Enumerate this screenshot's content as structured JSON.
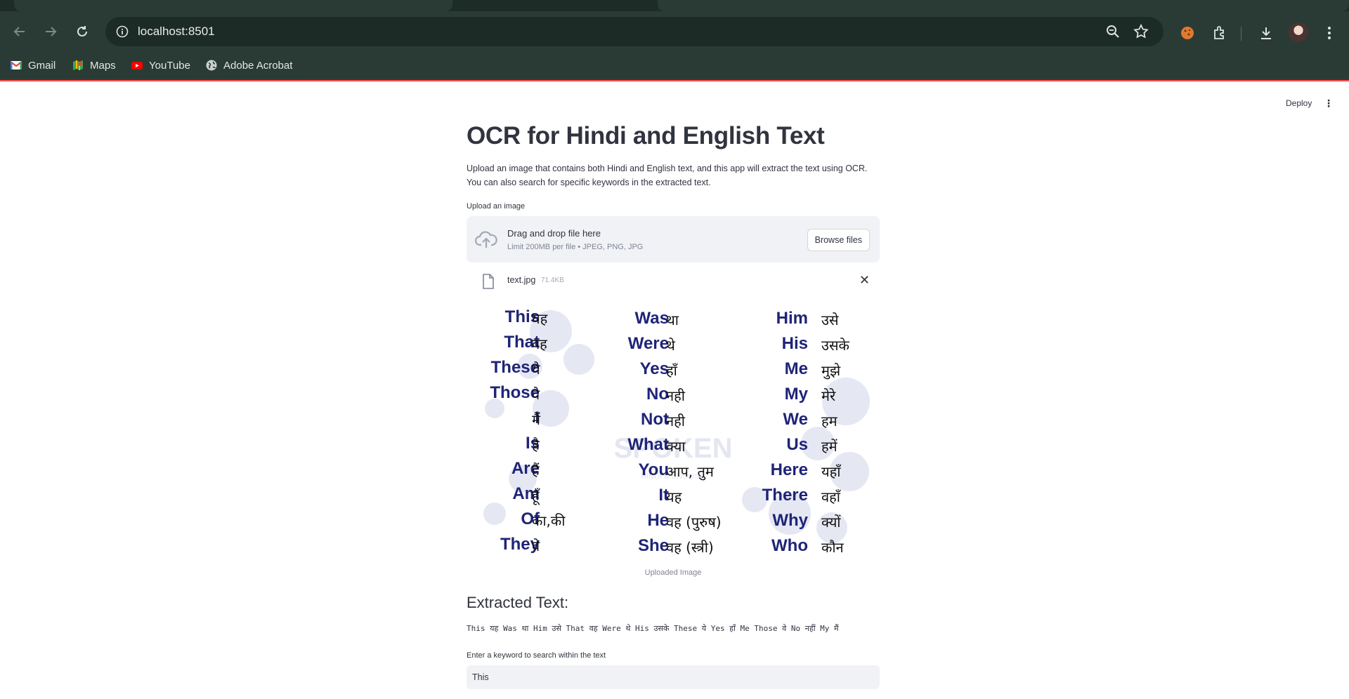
{
  "browser": {
    "url": "localhost:8501",
    "bookmarks": [
      {
        "label": "Gmail",
        "icon": "gmail-icon"
      },
      {
        "label": "Maps",
        "icon": "maps-icon"
      },
      {
        "label": "YouTube",
        "icon": "youtube-icon"
      },
      {
        "label": "Adobe Acrobat",
        "icon": "globe-icon"
      }
    ]
  },
  "app": {
    "deploy_label": "Deploy",
    "title": "OCR for Hindi and English Text",
    "description_line1": "Upload an image that contains both Hindi and English text, and this app will extract the text using OCR.",
    "description_line2": "You can also search for specific keywords in the extracted text.",
    "upload_label": "Upload an image",
    "dropzone_title": "Drag and drop file here",
    "dropzone_limit": "Limit 200MB per file • JPEG, PNG, JPG",
    "browse_label": "Browse files",
    "file_name": "text.jpg",
    "file_size": "71.4KB",
    "image_caption": "Uploaded Image",
    "extracted_heading": "Extracted Text:",
    "extracted_text": "This यह Was था Him उसे That वह Were थे His उसके These ये Yes हाँ Me Those वे No   नहीं My मैं",
    "keyword_label": "Enter a keyword to search within the text",
    "keyword_value": "This"
  },
  "image_words": {
    "col1": [
      {
        "en": "This",
        "hi": "यह"
      },
      {
        "en": "That",
        "hi": "वह"
      },
      {
        "en": "These",
        "hi": "ये"
      },
      {
        "en": "Those",
        "hi": "वे"
      },
      {
        "en": "I",
        "hi": "मैं"
      },
      {
        "en": "Is",
        "hi": "है"
      },
      {
        "en": "Are",
        "hi": "हैं"
      },
      {
        "en": "Am",
        "hi": "हूँ"
      },
      {
        "en": "Of",
        "hi": "का,की"
      },
      {
        "en": "They",
        "hi": "वे"
      }
    ],
    "col2": [
      {
        "en": "Was",
        "hi": "था"
      },
      {
        "en": "Were",
        "hi": "थे"
      },
      {
        "en": "Yes",
        "hi": "हाँ"
      },
      {
        "en": "No",
        "hi": "नही"
      },
      {
        "en": "Not",
        "hi": "नही"
      },
      {
        "en": "What",
        "hi": "क्या"
      },
      {
        "en": "You",
        "hi": "आप, तुम"
      },
      {
        "en": "It",
        "hi": "यह"
      },
      {
        "en": "He",
        "hi": "वह (पुरुष)"
      },
      {
        "en": "She",
        "hi": "वह (स्त्री)"
      }
    ],
    "col3": [
      {
        "en": "Him",
        "hi": "उसे"
      },
      {
        "en": "His",
        "hi": "उसके"
      },
      {
        "en": "Me",
        "hi": "मुझे"
      },
      {
        "en": "My",
        "hi": "मेरे"
      },
      {
        "en": "We",
        "hi": "हम"
      },
      {
        "en": "Us",
        "hi": "हमें"
      },
      {
        "en": "Here",
        "hi": "यहाँ"
      },
      {
        "en": "There",
        "hi": "वहाँ"
      },
      {
        "en": "Why",
        "hi": "क्यों"
      },
      {
        "en": "Who",
        "hi": "कौन"
      }
    ]
  }
}
